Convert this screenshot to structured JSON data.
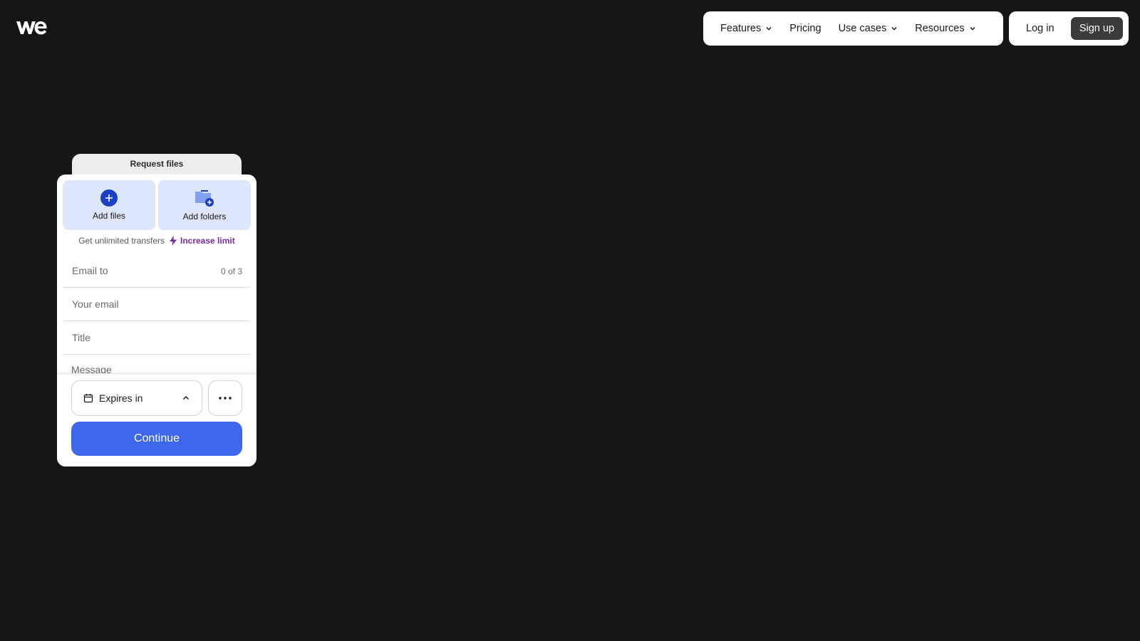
{
  "logo": {
    "icon": "wetransfer-logo-icon"
  },
  "nav": {
    "items": [
      {
        "label": "Features",
        "dropdown": true
      },
      {
        "label": "Pricing",
        "dropdown": false
      },
      {
        "label": "Use cases",
        "dropdown": true
      },
      {
        "label": "Resources",
        "dropdown": true
      }
    ],
    "login_label": "Log in",
    "signup_label": "Sign up"
  },
  "panel": {
    "request_tab": "Request files",
    "add_files_label": "Add files",
    "add_folders_label": "Add folders",
    "upgrade_text": "Get unlimited transfers",
    "upgrade_link": "Increase limit",
    "email_to_placeholder": "Email to",
    "email_to_count": "0 of 3",
    "your_email_placeholder": "Your email",
    "title_placeholder": "Title",
    "message_placeholder": "Message",
    "expires_label": "Expires in",
    "continue_label": "Continue"
  },
  "colors": {
    "background": "#151616",
    "accent_blue": "#3d68ec",
    "tile_blue": "#dde7fb",
    "upgrade_purple": "#7a2ca8"
  }
}
